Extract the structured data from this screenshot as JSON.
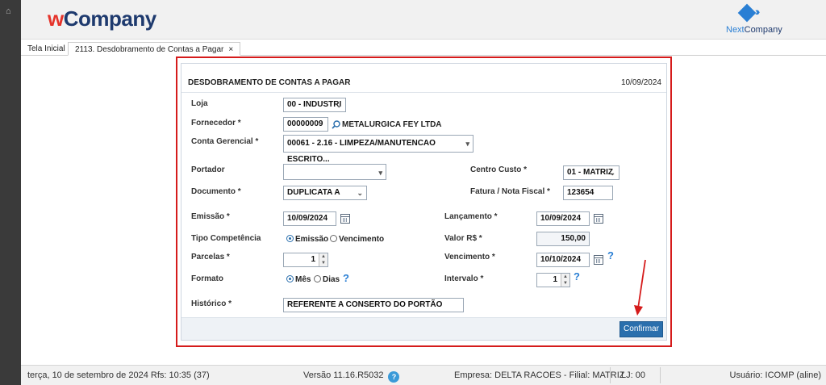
{
  "app": {
    "brand_w": "w",
    "brand_rest": "Company",
    "partner_prefix": "Next",
    "partner_suffix": "Company"
  },
  "tabs": {
    "home": "Tela Inicial",
    "active": "2113. Desdobramento de Contas a Pagar",
    "close": "×"
  },
  "form": {
    "title": "DESDOBRAMENTO DE CONTAS A PAGAR",
    "date": "10/09/2024",
    "loja": {
      "label": "Loja",
      "value": "00 - INDUSTRI"
    },
    "fornecedor": {
      "label": "Fornecedor *",
      "code": "00000009",
      "name": "METALURGICA FEY LTDA"
    },
    "conta_gerencial": {
      "label": "Conta Gerencial *",
      "value": "00061 - 2.16 - LIMPEZA/MANUTENCAO ESCRITO..."
    },
    "portador": {
      "label": "Portador",
      "value": ""
    },
    "centro_custo": {
      "label": "Centro Custo *",
      "value": "01 - MATRIZ"
    },
    "documento": {
      "label": "Documento *",
      "value": "DUPLICATA A"
    },
    "fatura": {
      "label": "Fatura / Nota Fiscal *",
      "value": "123654"
    },
    "emissao": {
      "label": "Emissão *",
      "value": "10/09/2024"
    },
    "lancamento": {
      "label": "Lançamento *",
      "value": "10/09/2024"
    },
    "tipo_competencia": {
      "label": "Tipo Competência",
      "opt1": "Emissão",
      "opt2": "Vencimento",
      "selected": "Emissão"
    },
    "valor": {
      "label": "Valor R$ *",
      "value": "150,00"
    },
    "parcelas": {
      "label": "Parcelas *",
      "value": "1"
    },
    "vencimento": {
      "label": "Vencimento *",
      "value": "10/10/2024"
    },
    "formato": {
      "label": "Formato",
      "opt1": "Mês",
      "opt2": "Dias",
      "selected": "Mês"
    },
    "intervalo": {
      "label": "Intervalo *",
      "value": "1"
    },
    "historico": {
      "label": "Histórico *",
      "value": "REFERENTE A CONSERTO DO PORTÃO"
    },
    "confirm_label": "Confirmar"
  },
  "status": {
    "datetime": "terça, 10 de setembro de 2024  Rfs: 10:35 (37)",
    "version": "Versão 11.16.R5032",
    "help": "?",
    "empresa": "Empresa: DELTA RACOES - Filial: MATRIZ",
    "lj": "LJ: 00",
    "usuario": "Usuário: ICOMP (aline)"
  },
  "colors": {
    "accent": "#2a6fad",
    "highlight": "#d51b1b",
    "brand_red": "#e5332a",
    "brand_navy": "#1e3a6e"
  }
}
